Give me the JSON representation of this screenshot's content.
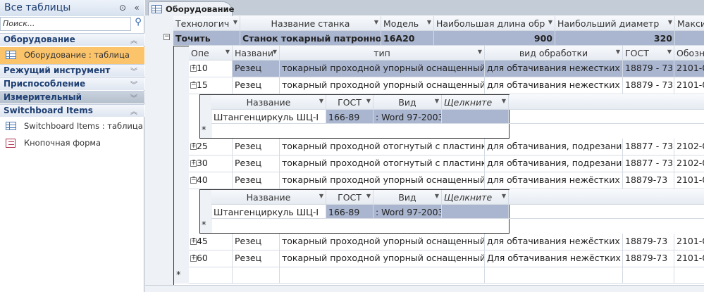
{
  "nav": {
    "title": "Все таблицы",
    "search_placeholder": "Поиск...",
    "groups": [
      {
        "label": "Оборудование",
        "chevron": "up",
        "items": [
          {
            "label": "Оборудование : таблица",
            "icon": "table-icon",
            "selected": true
          }
        ]
      },
      {
        "label": "Режущий инструмент",
        "chevron": "down",
        "items": []
      },
      {
        "label": "Приспособление",
        "chevron": "down",
        "items": []
      },
      {
        "label": "Измерительный инструмент",
        "chevron": "down",
        "items": []
      },
      {
        "label": "Switchboard Items",
        "chevron": "up",
        "items": [
          {
            "label": "Switchboard Items : таблица",
            "icon": "table-icon"
          },
          {
            "label": "Кнопочная форма",
            "icon": "form-icon"
          }
        ]
      }
    ]
  },
  "tab": {
    "label": "Оборудование"
  },
  "main": {
    "columns": [
      "Технологич",
      "Название станка",
      "Модель",
      "Наибольшая длина обр",
      "Наибольший диаметр",
      "Макси"
    ],
    "row": [
      "Точить",
      "Станок токарный патронно-це",
      "16А20",
      "900",
      "320",
      ""
    ]
  },
  "ops": {
    "columns": [
      "Опе",
      "Названи",
      "тип",
      "вид обработки",
      "ГОСТ",
      "Обозн"
    ],
    "rows": [
      {
        "cells": [
          "010",
          "Резец",
          "токарный проходной упорный оснащенный",
          "для обтачивания нежестких в",
          "18879 - 73",
          "2101-0"
        ],
        "expanded": false,
        "selected": true
      },
      {
        "cells": [
          "015",
          "Резец",
          "токарный проходной упорный оснащенный",
          "для обтачивания нежестких в",
          "18879 - 73",
          "2101-0"
        ],
        "expanded": true
      },
      {
        "cells": [
          "025",
          "Резец",
          "токарный проходной отогнутый с пластинка",
          "для обтачивания, подрезания",
          "18877 - 73",
          "2102-0"
        ],
        "expanded": false
      },
      {
        "cells": [
          "030",
          "Резец",
          "токарный проходной отогнутый с пластинка",
          "для обтачивания, подрезания",
          "18877 - 73",
          "2102-0"
        ],
        "expanded": false
      },
      {
        "cells": [
          "040",
          "Резец",
          "токарный проходной упорный оснащенный",
          "для обтачивания нежёстких в",
          "18879-73",
          "2101-0"
        ],
        "expanded": true
      },
      {
        "cells": [
          "045",
          "Резец",
          "токарный проходной упорный оснащенный",
          "для обтачивания нежёстких в",
          "18879-73",
          "2101-0"
        ],
        "expanded": false
      },
      {
        "cells": [
          "060",
          "Резец",
          "токарный проходной упорный оснащенный",
          "Для обтачивания нежёстких в",
          "18879-73",
          "2101-0"
        ],
        "expanded": false
      }
    ]
  },
  "tools": {
    "columns": [
      "Название",
      "ГОСТ",
      "Вид",
      "Щелкните"
    ],
    "row": [
      "Штангенциркуль ШЦ-I",
      "166-89",
      ": Word 97-2003",
      ""
    ]
  },
  "new_record_marker": "*"
}
